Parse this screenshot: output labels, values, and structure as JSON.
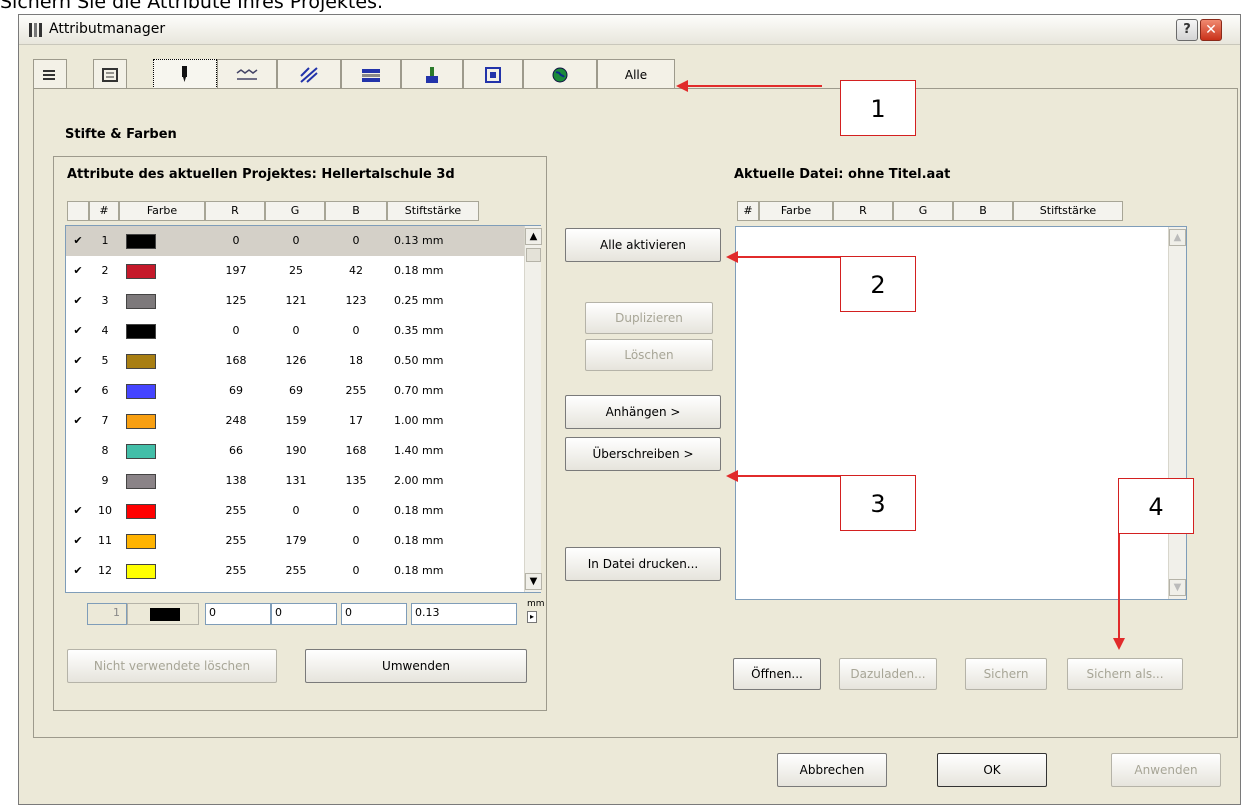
{
  "caption": "Sichern Sie die Attribute Ihres Projektes.",
  "window": {
    "title": "Attributmanager",
    "help_label": "?",
    "close_label": "✕"
  },
  "tabs": [
    {
      "id": "layers",
      "icon": "layers-icon"
    },
    {
      "id": "layer-combinations",
      "icon": "layer-combinations-icon"
    },
    {
      "id": "pens",
      "icon": "pen-icon",
      "active": true
    },
    {
      "id": "line-types",
      "icon": "line-types-icon"
    },
    {
      "id": "fill-types",
      "icon": "fill-types-icon"
    },
    {
      "id": "composites",
      "icon": "composites-icon"
    },
    {
      "id": "materials",
      "icon": "materials-icon"
    },
    {
      "id": "zones",
      "icon": "zones-icon"
    },
    {
      "id": "city",
      "icon": "globe-icon"
    },
    {
      "id": "all",
      "label": "Alle"
    }
  ],
  "section_title": "Stifte & Farben",
  "left": {
    "title": "Attribute des aktuellen Projektes: Hellertalschule 3d",
    "columns": [
      "#",
      "Farbe",
      "R",
      "G",
      "B",
      "Stiftstärke"
    ],
    "rows": [
      {
        "check": "✔",
        "num": "1",
        "color": "#000000",
        "r": "0",
        "g": "0",
        "b": "0",
        "w": "0.13 mm",
        "sel": true
      },
      {
        "check": "✔",
        "num": "2",
        "color": "#c5192a",
        "r": "197",
        "g": "25",
        "b": "42",
        "w": "0.18 mm"
      },
      {
        "check": "✔",
        "num": "3",
        "color": "#7d797b",
        "r": "125",
        "g": "121",
        "b": "123",
        "w": "0.25 mm"
      },
      {
        "check": "✔",
        "num": "4",
        "color": "#000000",
        "r": "0",
        "g": "0",
        "b": "0",
        "w": "0.35 mm"
      },
      {
        "check": "✔",
        "num": "5",
        "color": "#a87e12",
        "r": "168",
        "g": "126",
        "b": "18",
        "w": "0.50 mm"
      },
      {
        "check": "✔",
        "num": "6",
        "color": "#4545ff",
        "r": "69",
        "g": "69",
        "b": "255",
        "w": "0.70 mm"
      },
      {
        "check": "✔",
        "num": "7",
        "color": "#f89f11",
        "r": "248",
        "g": "159",
        "b": "17",
        "w": "1.00 mm"
      },
      {
        "check": "",
        "num": "8",
        "color": "#42bea8",
        "r": "66",
        "g": "190",
        "b": "168",
        "w": "1.40 mm"
      },
      {
        "check": "",
        "num": "9",
        "color": "#8a8387",
        "r": "138",
        "g": "131",
        "b": "135",
        "w": "2.00 mm"
      },
      {
        "check": "✔",
        "num": "10",
        "color": "#ff0000",
        "r": "255",
        "g": "0",
        "b": "0",
        "w": "0.18 mm"
      },
      {
        "check": "✔",
        "num": "11",
        "color": "#ffb300",
        "r": "255",
        "g": "179",
        "b": "0",
        "w": "0.18 mm"
      },
      {
        "check": "✔",
        "num": "12",
        "color": "#ffff00",
        "r": "255",
        "g": "255",
        "b": "0",
        "w": "0.18 mm"
      }
    ],
    "edit": {
      "num": "1",
      "r": "0",
      "g": "0",
      "b": "0",
      "w": "0.13",
      "unit": "mm"
    },
    "btn_delete_unused": "Nicht verwendete löschen",
    "btn_apply": "Umwenden"
  },
  "middle": {
    "activate_all": "Alle aktivieren",
    "duplicate": "Duplizieren",
    "delete": "Löschen",
    "append": "Anhängen >",
    "overwrite": "Überschreiben >",
    "print": "In Datei drucken..."
  },
  "right": {
    "title": "Aktuelle Datei: ohne Titel.aat",
    "columns": [
      "#",
      "Farbe",
      "R",
      "G",
      "B",
      "Stiftstärke"
    ],
    "open": "Öffnen...",
    "reload": "Dazuladen...",
    "save": "Sichern",
    "save_as": "Sichern als..."
  },
  "footer": {
    "cancel": "Abbrechen",
    "ok": "OK",
    "apply": "Anwenden"
  },
  "callouts": [
    "1",
    "2",
    "3",
    "4"
  ],
  "colors": {
    "annotation": "#e12b2b",
    "dialog_bg": "#ece9d8"
  }
}
